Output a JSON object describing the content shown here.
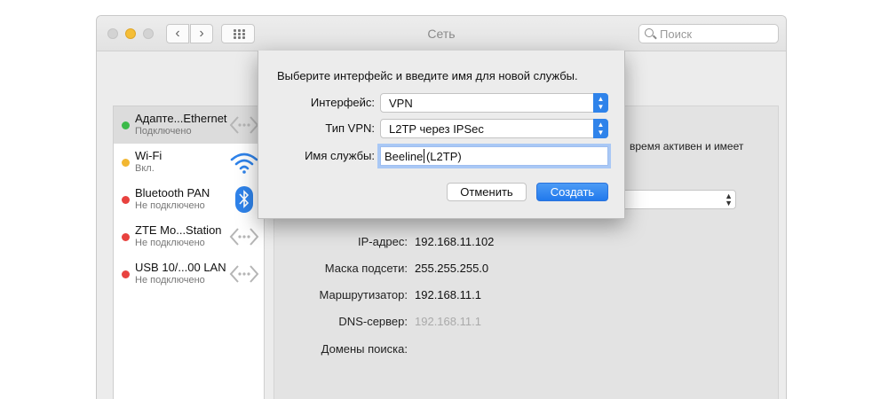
{
  "window": {
    "title": "Сеть",
    "search_placeholder": "Поиск"
  },
  "sidebar": {
    "items": [
      {
        "name": "Адапте...Ethernet",
        "status": "Подключено",
        "dot": "#3cba4a",
        "icon": "ethernet-arrows-icon",
        "selected": true
      },
      {
        "name": "Wi-Fi",
        "status": "Вкл.",
        "dot": "#f2b731",
        "icon": "wifi-icon",
        "selected": false
      },
      {
        "name": "Bluetooth PAN",
        "status": "Не подключено",
        "dot": "#e8423f",
        "icon": "bluetooth-icon",
        "selected": false
      },
      {
        "name": "ZTE Mo...Station",
        "status": "Не подключено",
        "dot": "#e8423f",
        "icon": "ethernet-arrows-icon",
        "selected": false
      },
      {
        "name": "USB 10/...00 LAN",
        "status": "Не подключено",
        "dot": "#e8423f",
        "icon": "ethernet-arrows-icon",
        "selected": false
      }
    ]
  },
  "main": {
    "partial_text": "время активен и имеет",
    "rows": [
      {
        "label": "IP-адрес:",
        "value": "192.168.11.102",
        "dim": false
      },
      {
        "label": "Маска подсети:",
        "value": "255.255.255.0",
        "dim": false
      },
      {
        "label": "Маршрутизатор:",
        "value": "192.168.11.1",
        "dim": false
      },
      {
        "label": "DNS-сервер:",
        "value": "192.168.11.1",
        "dim": true
      },
      {
        "label": "Домены поиска:",
        "value": "",
        "dim": false
      }
    ]
  },
  "dialog": {
    "prompt": "Выберите интерфейс и введите имя для новой службы.",
    "interface_label": "Интерфейс:",
    "interface_value": "VPN",
    "vpn_type_label": "Тип VPN:",
    "vpn_type_value": "L2TP через IPSec",
    "service_name_label": "Имя службы:",
    "service_name_value": "Beeline (L2TP)",
    "cancel_label": "Отменить",
    "create_label": "Создать"
  },
  "colors": {
    "accent": "#2f83ea",
    "status_green": "#3cba4a",
    "status_yellow": "#f2b731",
    "status_red": "#e8423f"
  }
}
